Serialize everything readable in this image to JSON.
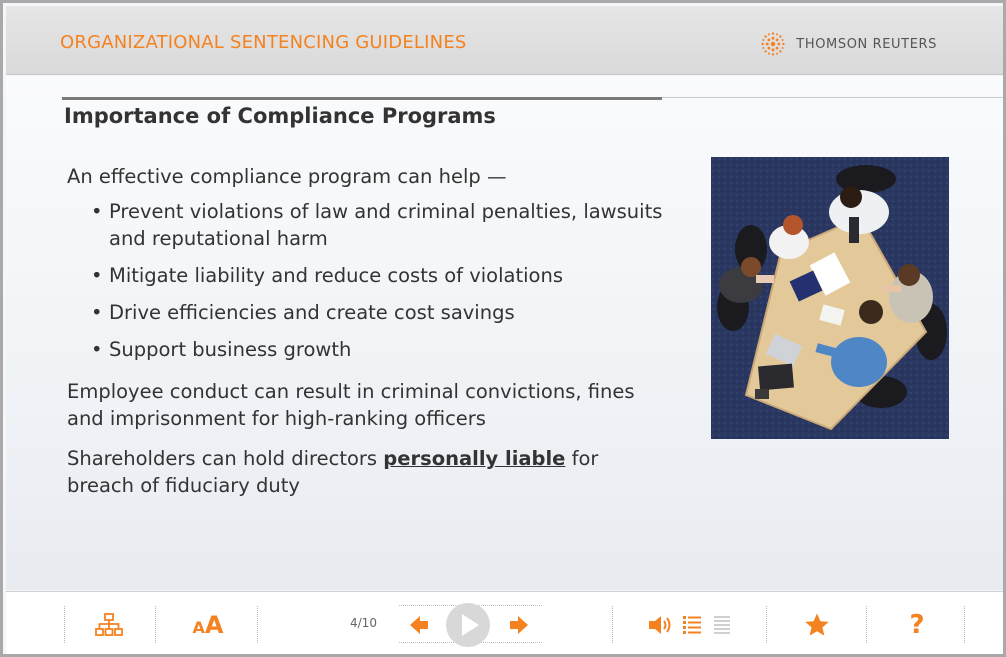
{
  "header": {
    "course_title": "ORGANIZATIONAL SENTENCING GUIDELINES",
    "brand_name": "THOMSON REUTERS"
  },
  "slide": {
    "title": "Importance of Compliance Programs",
    "intro": "An effective compliance program can help —",
    "bullets": [
      "Prevent violations of law and criminal penalties, lawsuits and reputational harm",
      "Mitigate liability and reduce costs of violations",
      "Drive efficiencies and create cost savings",
      "Support business growth"
    ],
    "paragraph_1": "Employee conduct can result in criminal convictions, fines and imprisonment for high-ranking officers",
    "paragraph_2_before": "Shareholders can hold directors ",
    "paragraph_2_link": "personally liable",
    "paragraph_2_after": " for breach of fiduciary duty"
  },
  "footer": {
    "page_counter": "4/10",
    "text_size_label": "AA",
    "help_label": "?"
  },
  "colors": {
    "accent": "#f58220",
    "icon_gray": "#d0d0d0"
  }
}
